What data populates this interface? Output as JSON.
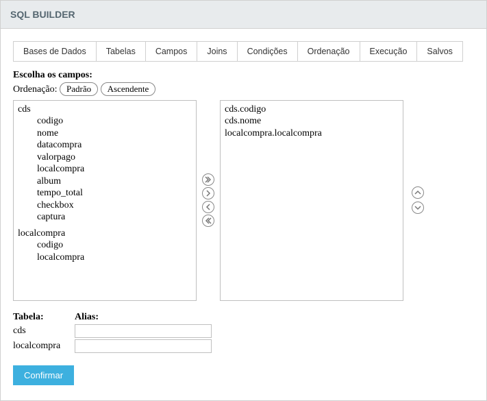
{
  "header": {
    "title": "SQL BUILDER"
  },
  "tabs": [
    {
      "label": "Bases de Dados"
    },
    {
      "label": "Tabelas"
    },
    {
      "label": "Campos"
    },
    {
      "label": "Joins"
    },
    {
      "label": "Condições"
    },
    {
      "label": "Ordenação"
    },
    {
      "label": "Execução"
    },
    {
      "label": "Salvos"
    }
  ],
  "section": {
    "choose_fields": "Escolha os campos:",
    "ordering_label": "Ordenação:",
    "order_default": "Padrão",
    "order_asc": "Ascendente"
  },
  "left_list": {
    "groups": [
      {
        "name": "cds",
        "fields": [
          "codigo",
          "nome",
          "datacompra",
          "valorpago",
          "localcompra",
          "album",
          "tempo_total",
          "checkbox",
          "captura"
        ]
      },
      {
        "name": "localcompra",
        "fields": [
          "codigo",
          "localcompra"
        ]
      }
    ]
  },
  "right_list": {
    "items": [
      "cds.codigo",
      "cds.nome",
      "localcompra.localcompra"
    ]
  },
  "alias": {
    "header_table": "Tabela:",
    "header_alias": "Alias:",
    "rows": [
      {
        "table": "cds",
        "alias": ""
      },
      {
        "table": "localcompra",
        "alias": ""
      }
    ]
  },
  "buttons": {
    "confirm": "Confirmar"
  }
}
